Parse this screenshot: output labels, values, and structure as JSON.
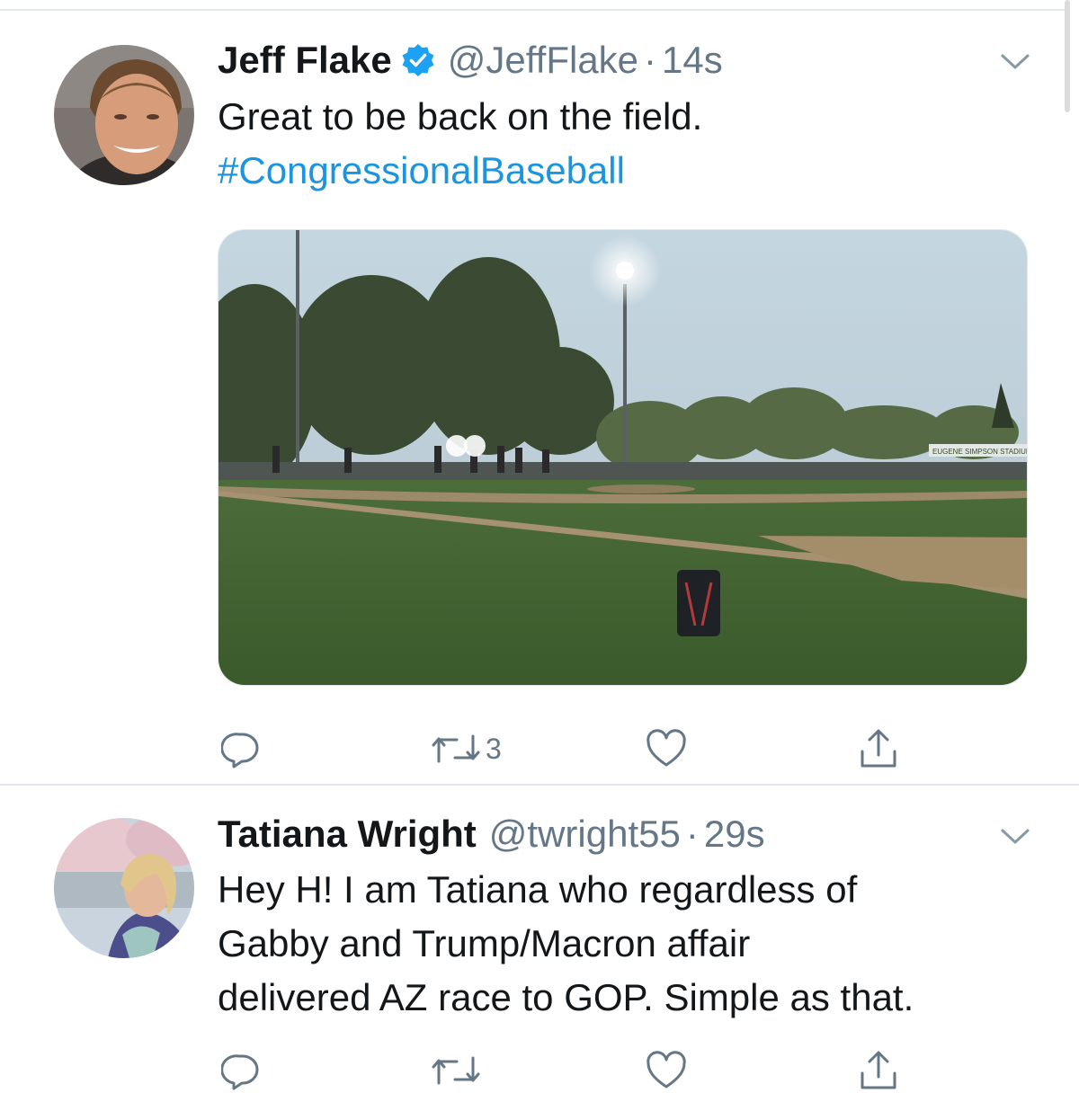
{
  "tweets": [
    {
      "name": "Jeff Flake",
      "verified": true,
      "handle": "@JeffFlake",
      "separator": "·",
      "time": "14s",
      "text_line1": "Great to be back on the field.",
      "hashtag": "#CongressionalBaseball",
      "media_sign": "EUGENE SIMPSON STADIUM",
      "actions": {
        "replies": "",
        "retweets": "3",
        "likes": ""
      }
    },
    {
      "name": "Tatiana Wright",
      "verified": false,
      "handle": "@twright55",
      "separator": "·",
      "time": "29s",
      "lines": [
        "Hey H! I am Tatiana who regardless of",
        "Gabby and Trump/Macron affair",
        "delivered AZ race to GOP. Simple as that."
      ]
    }
  ],
  "colors": {
    "link": "#1b95e0",
    "secondary": "#657786",
    "divider": "#e1e8ed",
    "verified": "#1da1f2"
  },
  "icons": [
    "chevron-down-icon",
    "verified-badge-icon",
    "reply-icon",
    "retweet-icon",
    "like-icon",
    "share-icon"
  ]
}
